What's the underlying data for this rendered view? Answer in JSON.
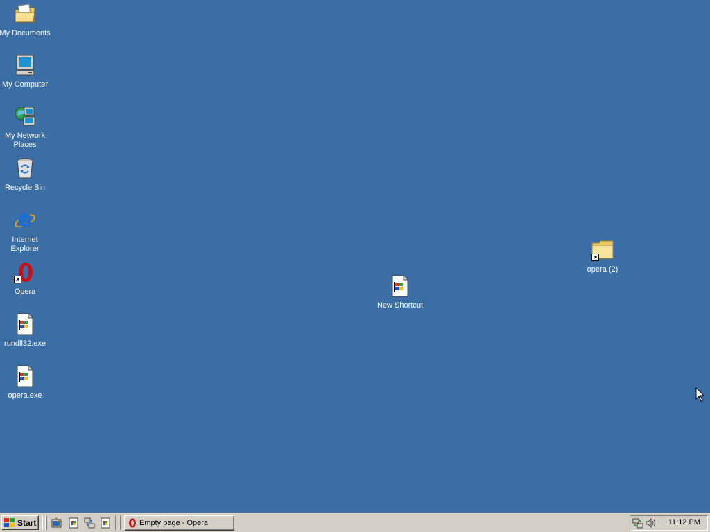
{
  "desktop": {
    "background_color": "#3a6ea5",
    "icons": [
      {
        "label": "My Documents",
        "icon": "my-documents-icon"
      },
      {
        "label": "My Computer",
        "icon": "my-computer-icon"
      },
      {
        "label": "My Network Places",
        "icon": "my-network-places-icon"
      },
      {
        "label": "Recycle Bin",
        "icon": "recycle-bin-icon"
      },
      {
        "label": "Internet Explorer",
        "icon": "internet-explorer-icon"
      },
      {
        "label": "Opera",
        "icon": "opera-icon"
      },
      {
        "label": "rundll32.exe",
        "icon": "executable-icon"
      },
      {
        "label": "opera.exe",
        "icon": "executable-icon"
      },
      {
        "label": "New Shortcut",
        "icon": "executable-icon"
      },
      {
        "label": "opera (2)",
        "icon": "folder-shortcut-icon"
      }
    ]
  },
  "taskbar": {
    "start_label": "Start",
    "quick_launch": [
      "show-desktop-icon",
      "app-icon",
      "network-icon",
      "app-icon"
    ],
    "task_button_label": "Empty page - Opera",
    "tray_icons": [
      "network-tray-icon",
      "volume-icon"
    ],
    "clock": "11:12 PM"
  }
}
